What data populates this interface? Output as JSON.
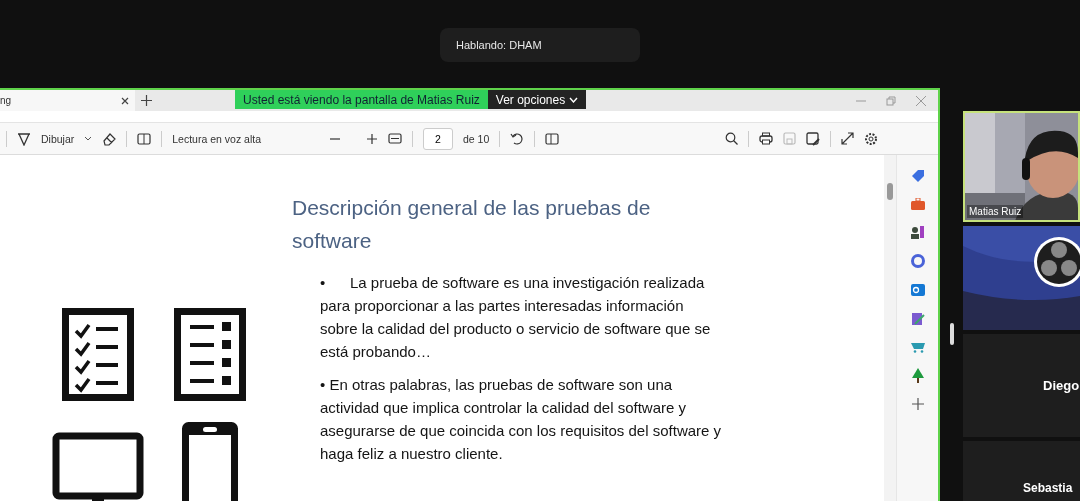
{
  "speaking_indicator": {
    "text": "Hablando: DHAM"
  },
  "browser": {
    "tabs": [
      {
        "label": "ng",
        "selected": true
      }
    ],
    "share_banner": {
      "text": "Usted está viendo la pantalla de Matias Ruiz",
      "options": "Ver opciones"
    },
    "toolbar": {
      "draw": "Dibujar",
      "read_aloud": "Lectura en voz alta",
      "page": "2",
      "page_total": "de 10"
    },
    "slide": {
      "title": "Descripción general de las pruebas de software",
      "bullets": [
        {
          "marker": "•",
          "text": "La prueba de software es una investigación realizada para proporcionar a las partes interesadas información sobre la calidad del producto o servicio de software que se está probando…"
        },
        {
          "text": "• En otras palabras, las pruebas de software son una actividad que implica controlar la calidad del software y asegurarse de que coincida con los requisitos del software y haga feliz a nuestro cliente."
        }
      ]
    }
  },
  "participants": [
    {
      "kind": "video",
      "name": "Matias Ruiz",
      "selected": true
    },
    {
      "kind": "logo",
      "selected": false
    },
    {
      "kind": "name",
      "name": "Diego",
      "selected": false
    },
    {
      "kind": "name",
      "name": "Sebastia",
      "selected": false
    }
  ]
}
